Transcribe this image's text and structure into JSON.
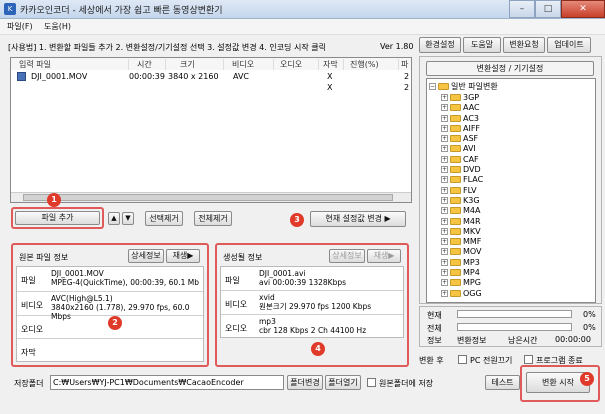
{
  "window": {
    "title": "카카오인코더 - 세상에서 가장 쉽고 빠른 동영상변환기",
    "icon_text": "K",
    "min": "–",
    "max": "□",
    "close": "✕"
  },
  "menu": [
    "파일(F)",
    "도움(H)"
  ],
  "usage_text": "[사용법] 1. 변환할 파일들 추가  2. 변환설정/기기설정 선택  3. 설정값 변경  4. 인코딩 시작 클릭",
  "version": "Ver 1.80",
  "top_buttons": [
    "환경설정",
    "도움말",
    "변환요청",
    "업데이트"
  ],
  "file_table": {
    "columns": [
      "입력 파일",
      "시간",
      "크기",
      "비디오",
      "오디오",
      "자막",
      "진행(%)",
      "파"
    ],
    "rows": [
      {
        "file": "DJI_0001.MOV",
        "time": "00:00:39",
        "size": "3840 x 2160",
        "video": "AVC",
        "audio": "",
        "subtitle": "X",
        "progress": "",
        "extra": "2"
      },
      {
        "file": "",
        "time": "",
        "size": "",
        "video": "",
        "audio": "",
        "subtitle": "X",
        "progress": "",
        "extra": "2"
      }
    ]
  },
  "action_row": {
    "add_file": "파일 추가",
    "up": "▲",
    "down": "▼",
    "remove_selected": "선택제거",
    "remove_all": "전체제거",
    "apply_current": "현재 설정값 변경 ▶"
  },
  "badges": [
    "1",
    "2",
    "3",
    "4",
    "5"
  ],
  "source_info": {
    "title": "원본 파일 정보",
    "detail_btn": "상세정보",
    "play_btn": "재생▶",
    "rows": [
      {
        "label": "파일",
        "value": "DJI_0001.MOV\nMPEG-4(QuickTime), 00:00:39, 60.1 Mb"
      },
      {
        "label": "비디오",
        "value": "AVC(High@L5.1)\n3840x2160 (1.778), 29.970 fps, 60.0 Mbps"
      },
      {
        "label": "오디오",
        "value": ""
      },
      {
        "label": "자막",
        "value": ""
      }
    ]
  },
  "output_info": {
    "title": "생성될 정보",
    "detail_btn": "상세정보",
    "play_btn": "재생▶",
    "rows": [
      {
        "label": "파일",
        "value": "DJI_0001.avi\navi  00:00:39  1328Kbps"
      },
      {
        "label": "비디오",
        "value": "xvid\n원본크기  29.970 fps  1200 Kbps"
      },
      {
        "label": "오디오",
        "value": "mp3\ncbr  128 Kbps  2 Ch  44100 Hz"
      }
    ]
  },
  "tree": {
    "header": "변환설정 / 기기설정",
    "root": "일반 파일변환",
    "items": [
      "3GP",
      "AAC",
      "AC3",
      "AIFF",
      "ASF",
      "AVI",
      "CAF",
      "DVD",
      "FLAC",
      "FLV",
      "K3G",
      "M4A",
      "M4R",
      "MKV",
      "MMF",
      "MOV",
      "MP3",
      "MP4",
      "MPG",
      "OGG"
    ]
  },
  "progress": {
    "current_label": "현재",
    "current_pct": "0%",
    "current_value": 0,
    "total_label": "전체",
    "total_pct": "0%",
    "total_value": 0,
    "info_label": "정보",
    "conversion_info": "변환정보",
    "remaining": "남은시간",
    "remaining_value": "00:00:00"
  },
  "after_convert": {
    "label": "변환 후",
    "pc_shutdown": "PC 전원끄기",
    "exit_program": "프로그램 종료"
  },
  "save_folder": {
    "label": "저장폴더",
    "path": "C:₩Users₩YJ-PC1₩Documents₩CacaoEncoder",
    "change_btn": "폴더변경",
    "open_btn": "폴더열기",
    "same_as_source": "원본폴더에 저장"
  },
  "bottom_buttons": {
    "test": "테스트",
    "start": "변환 시작"
  }
}
